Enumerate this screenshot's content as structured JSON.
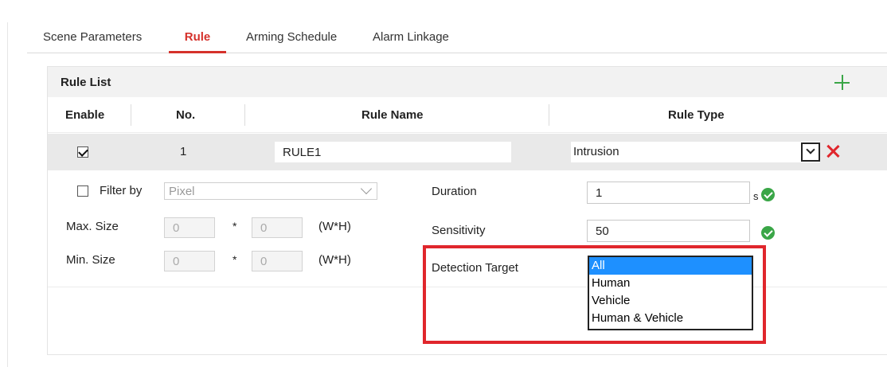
{
  "tabs": [
    {
      "label": "Scene Parameters",
      "active": false
    },
    {
      "label": "Rule",
      "active": true
    },
    {
      "label": "Arming Schedule",
      "active": false
    },
    {
      "label": "Alarm Linkage",
      "active": false
    }
  ],
  "rule_list": {
    "title": "Rule List",
    "add_icon": "plus-icon",
    "columns": [
      "Enable",
      "No.",
      "Rule Name",
      "Rule Type"
    ],
    "rows": [
      {
        "enabled": true,
        "no": "1",
        "name": "RULE1",
        "type": "Intrusion",
        "delete_icon": "close-icon"
      }
    ]
  },
  "detail": {
    "filter_by": {
      "label": "Filter by",
      "checked": false,
      "value": "Pixel"
    },
    "max_size": {
      "label": "Max. Size",
      "w": "0",
      "h": "0",
      "separator": "*",
      "unit": "(W*H)"
    },
    "min_size": {
      "label": "Min. Size",
      "w": "0",
      "h": "0",
      "separator": "*",
      "unit": "(W*H)"
    },
    "duration": {
      "label": "Duration",
      "value": "1",
      "unit": "s"
    },
    "sensitivity": {
      "label": "Sensitivity",
      "value": "50"
    },
    "detection_target": {
      "label": "Detection Target",
      "options": [
        "All",
        "Human",
        "Vehicle",
        "Human & Vehicle"
      ],
      "selected": "All"
    }
  },
  "colors": {
    "accent": "#d5312b",
    "ok": "#3aa647",
    "selected": "#1e90ff",
    "highlight": "#e0262c"
  }
}
